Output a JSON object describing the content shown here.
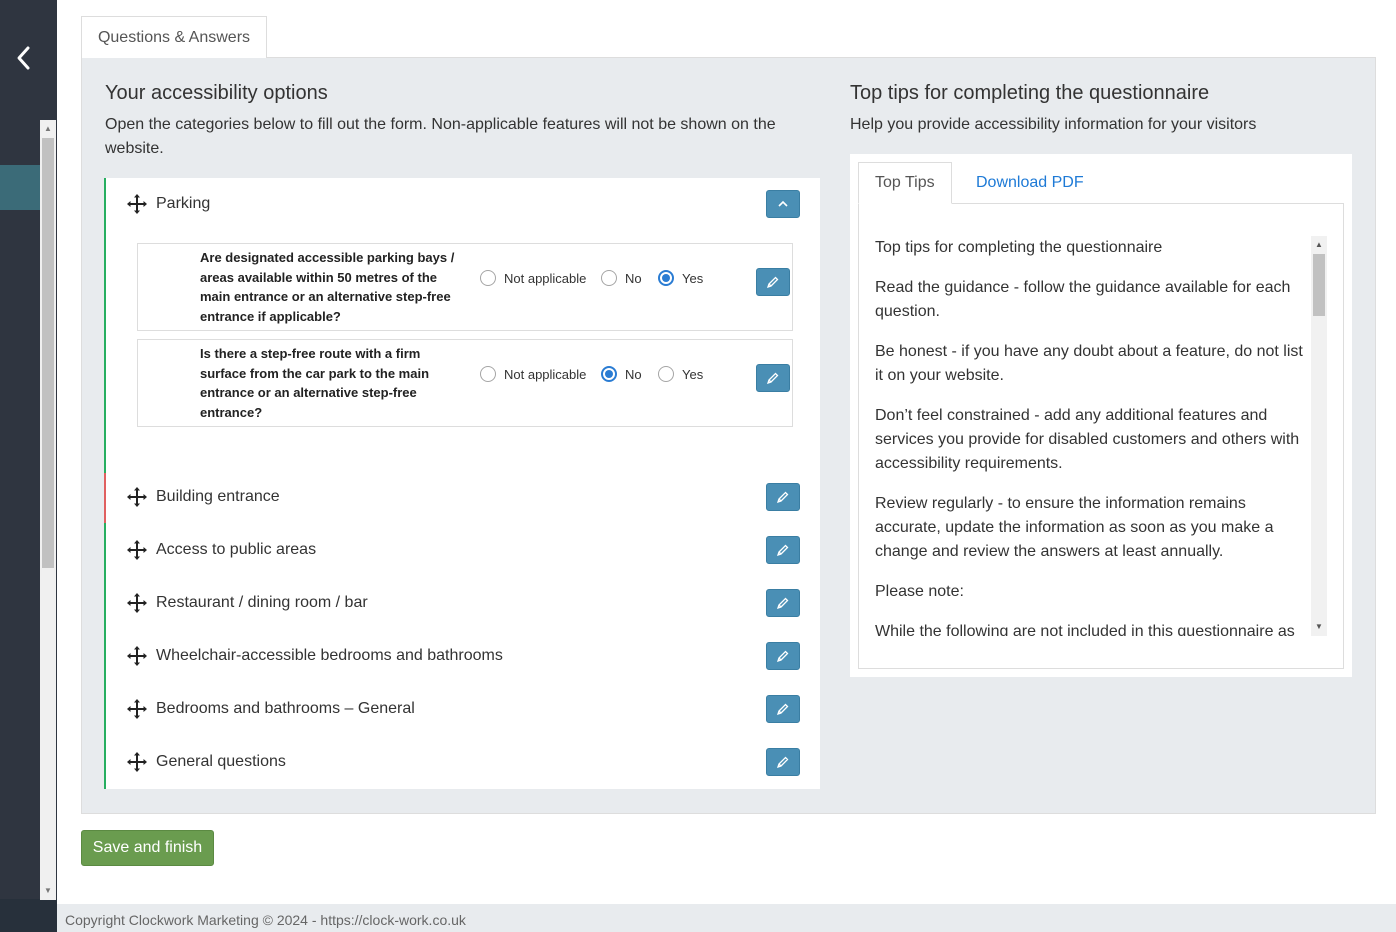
{
  "main_tab": {
    "label": "Questions & Answers"
  },
  "left": {
    "title": "Your accessibility options",
    "description": "Open the categories below to fill out the form. Non-applicable features will not be shown on the website."
  },
  "accordion": {
    "parking": {
      "label": "Parking",
      "questions": [
        {
          "text": "Are designated accessible parking bays / areas available within 50 metres of the main entrance or an alternative step-free entrance if applicable?",
          "selected": "Yes"
        },
        {
          "text": "Is there a step-free route with a firm surface from the car park to the main entrance or an alternative step-free entrance?",
          "selected": "No"
        }
      ]
    },
    "options": {
      "not_applicable": "Not applicable",
      "no": "No",
      "yes": "Yes"
    },
    "sections": [
      {
        "label": "Building entrance"
      },
      {
        "label": "Access to public areas"
      },
      {
        "label": "Restaurant / dining room / bar"
      },
      {
        "label": "Wheelchair-accessible bedrooms and bathrooms"
      },
      {
        "label": "Bedrooms and bathrooms – General"
      },
      {
        "label": "General questions"
      }
    ]
  },
  "right": {
    "title": "Top tips for completing the questionnaire",
    "description": "Help you provide accessibility information for your visitors"
  },
  "tips": {
    "tabs": {
      "active": "Top Tips",
      "download": "Download PDF"
    },
    "paragraphs": [
      "Top tips for completing the questionnaire",
      "Read the guidance - follow the guidance available for each question.",
      "Be honest - if you have any doubt about a feature, do not list it on your website.",
      "Don’t feel constrained - add any additional features and services you provide for disabled customers and others with accessibility requirements.",
      "Review regularly - to ensure the information remains accurate, update the information as soon as you make a change and review the answers at least annually.",
      "Please note:",
      "While the following are not included in this questionnaire as"
    ]
  },
  "save_button": {
    "label": "Save and finish"
  },
  "footer": {
    "text": "Copyright Clockwork Marketing © 2024 - https://clock-work.co.uk"
  },
  "colors": {
    "accent": "#4a8fb5",
    "success": "#6a9c4f",
    "sidebar": "#2f3540",
    "radio_selected": "#2a7cd3"
  }
}
